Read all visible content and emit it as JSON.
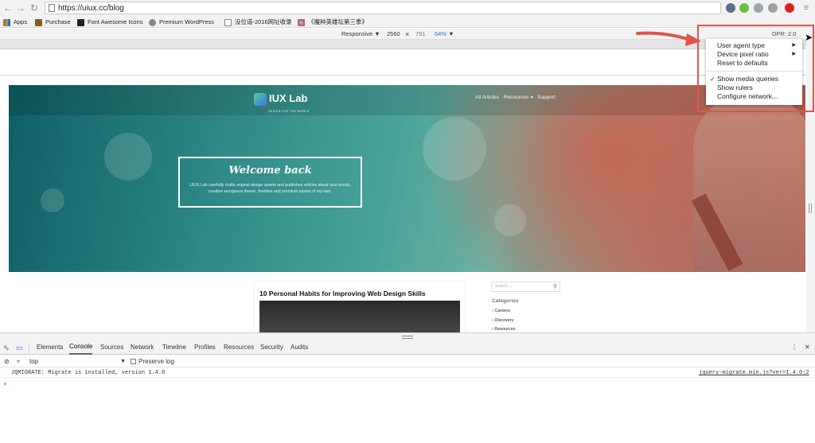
{
  "browser": {
    "url": "https://uiux.cc/blog",
    "bookmarks": [
      "Apps",
      "Purchase",
      "Font Awesome Icons",
      "Premium WordPress",
      "没位道-2016网址收录",
      "《魔种英雄坛第三季》"
    ]
  },
  "device_toolbar": {
    "mode": "Responsive",
    "width": "2560",
    "times": "×",
    "height": "791",
    "zoom": "64%",
    "dpr": "DPR: 2.0"
  },
  "dropdown": {
    "items": [
      {
        "label": "User agent type",
        "submenu": true,
        "checked": false
      },
      {
        "label": "Device pixel ratio",
        "submenu": true,
        "checked": false
      },
      {
        "label": "Reset to defaults",
        "submenu": false,
        "checked": false
      },
      {
        "label": "Show media queries",
        "submenu": false,
        "checked": true
      },
      {
        "label": "Show rulers",
        "submenu": false,
        "checked": false
      },
      {
        "label": "Configure network...",
        "submenu": false,
        "checked": false
      }
    ],
    "highlight_color": "#e0554a"
  },
  "site": {
    "logo": "IUX Lab",
    "logo_tagline": "DESIGN FOR THE WORLD",
    "nav": [
      "All Articles",
      "Resources",
      "Support"
    ],
    "welcome_title": "Welcome back",
    "welcome_text": "UIUX Lab carefully crafts original design assets and publishes articles about uiux trends, creative wordpress theme, freebies and premium assets of my own.",
    "post_title": "10 Personal Habits for Improving Web Design Skills",
    "search_placeholder": "Search ...",
    "categories_heading": "Categories",
    "categories": [
      "Careers",
      "Discovery",
      "Resources"
    ]
  },
  "devtools": {
    "tabs": [
      "Elements",
      "Console",
      "Sources",
      "Network",
      "Timeline",
      "Profiles",
      "Resources",
      "Security",
      "Audits"
    ],
    "active_tab": "Console",
    "context": "top",
    "preserve_log": "Preserve log",
    "messages": [
      {
        "text": "JQMIGRATE: Migrate is installed, version 1.4.0",
        "source": "jquery-migrate.min.js?ver=1.4.0:2"
      }
    ]
  }
}
